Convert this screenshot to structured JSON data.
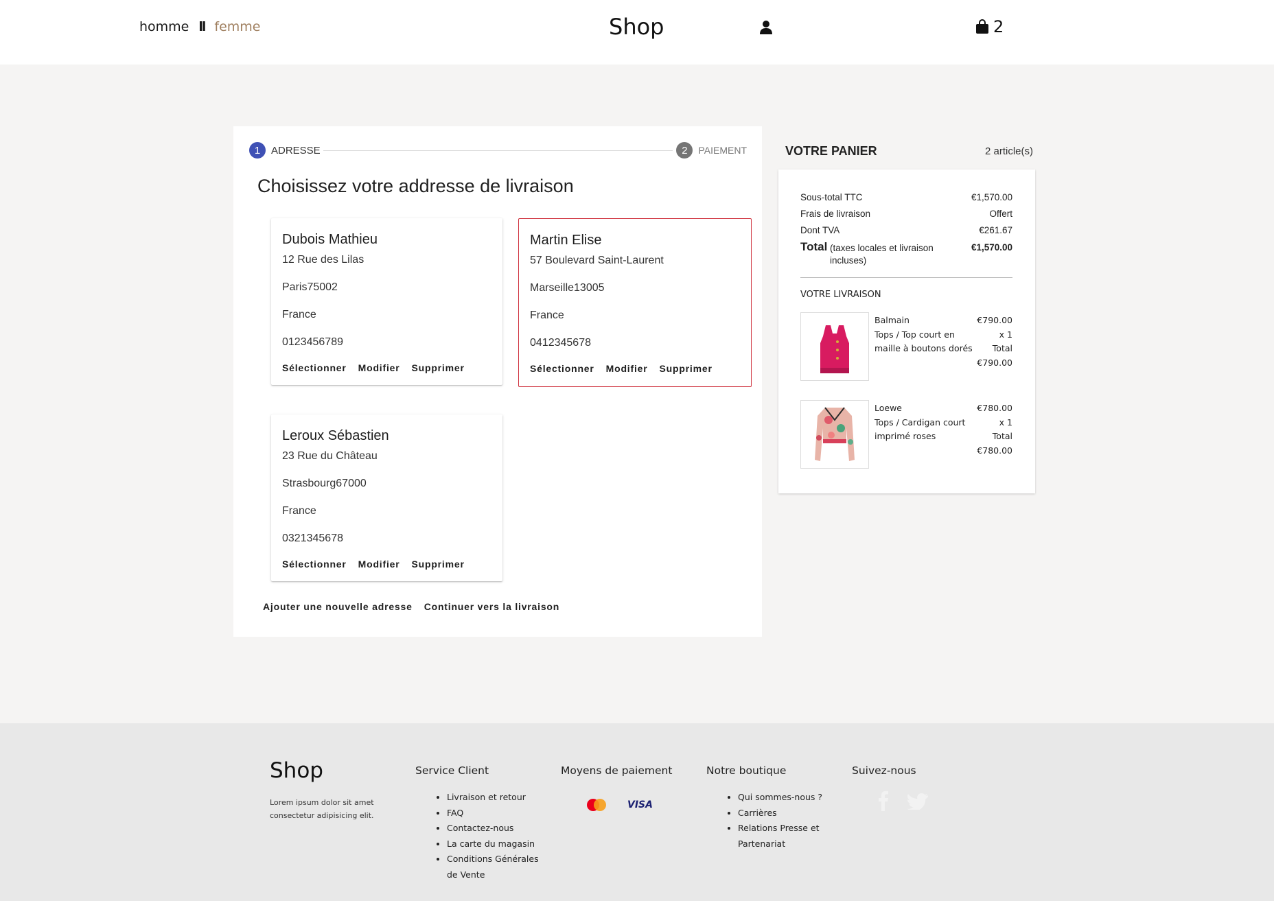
{
  "header": {
    "nav_homme": "homme",
    "nav_separator": "ll",
    "nav_femme": "femme",
    "brand": "Shop",
    "user_icon": "user-icon",
    "cart_icon": "shopping-bag-icon",
    "cart_count": "2"
  },
  "stepper": {
    "step1_number": "1",
    "step1_label": "ADRESSE",
    "step2_number": "2",
    "step2_label": "PAIEMENT"
  },
  "main": {
    "title": "Choisissez votre addresse de livraison",
    "addresses": [
      {
        "name": "Dubois Mathieu",
        "street": "12 Rue des Lilas",
        "city": "Paris75002",
        "country": "France",
        "phone": "0123456789",
        "selected": false
      },
      {
        "name": "Martin Elise",
        "street": "57 Boulevard Saint-Laurent",
        "city": "Marseille13005",
        "country": "France",
        "phone": "0412345678",
        "selected": true
      },
      {
        "name": "Leroux Sébastien",
        "street": "23 Rue du Château",
        "city": "Strasbourg67000",
        "country": "France",
        "phone": "0321345678",
        "selected": false
      }
    ],
    "select_label": "Sélectionner",
    "edit_label": "Modifier",
    "delete_label": "Supprimer",
    "add_address_label": "Ajouter une nouvelle adresse",
    "continue_label": "Continuer vers la livraison"
  },
  "cart": {
    "title": "VOTRE PANIER",
    "count": "2 article(s)",
    "subtotal_label": "Sous-total TTC",
    "subtotal_value": "€1,570.00",
    "shipping_label": "Frais de livraison",
    "shipping_value": "Offert",
    "tva_label": "Dont TVA",
    "tva_value": "€261.67",
    "total_label": "Total",
    "total_note": "(taxes locales et livraison incluses)",
    "total_value": "€1,570.00",
    "delivery_title": "VOTRE LIVRAISON",
    "items": [
      {
        "brand": "Balmain",
        "description": "Tops / Top court en maille à boutons dorés",
        "price": "€790.00",
        "quantity": "x 1",
        "total_label": "Total",
        "total_value": "€790.00",
        "image": "pink-knit-crop-top"
      },
      {
        "brand": "Loewe",
        "description": "Tops / Cardigan court imprimé roses",
        "price": "€780.00",
        "quantity": "x 1",
        "total_label": "Total",
        "total_value": "€780.00",
        "image": "floral-print-cardigan"
      }
    ]
  },
  "footer": {
    "brand": "Shop",
    "lorem": "Lorem ipsum dolor sit amet consectetur adipisicing elit.",
    "service_title": "Service Client",
    "service_links": [
      "Livraison et retour",
      "FAQ",
      "Contactez-nous",
      "La carte du magasin",
      "Conditions Générales de Vente"
    ],
    "payment_title": "Moyens de paiement",
    "visa_label": "VISA",
    "boutique_title": "Notre boutique",
    "boutique_links": [
      "Qui sommes-nous ?",
      "Carrières",
      "Relations Presse et Partenariat"
    ],
    "social_title": "Suivez-nous",
    "social_icons": [
      "facebook-icon",
      "twitter-icon"
    ]
  },
  "colors": {
    "accent_step": "#3f51b5",
    "selected_border": "#d0333f",
    "femme_link": "#a08060"
  }
}
